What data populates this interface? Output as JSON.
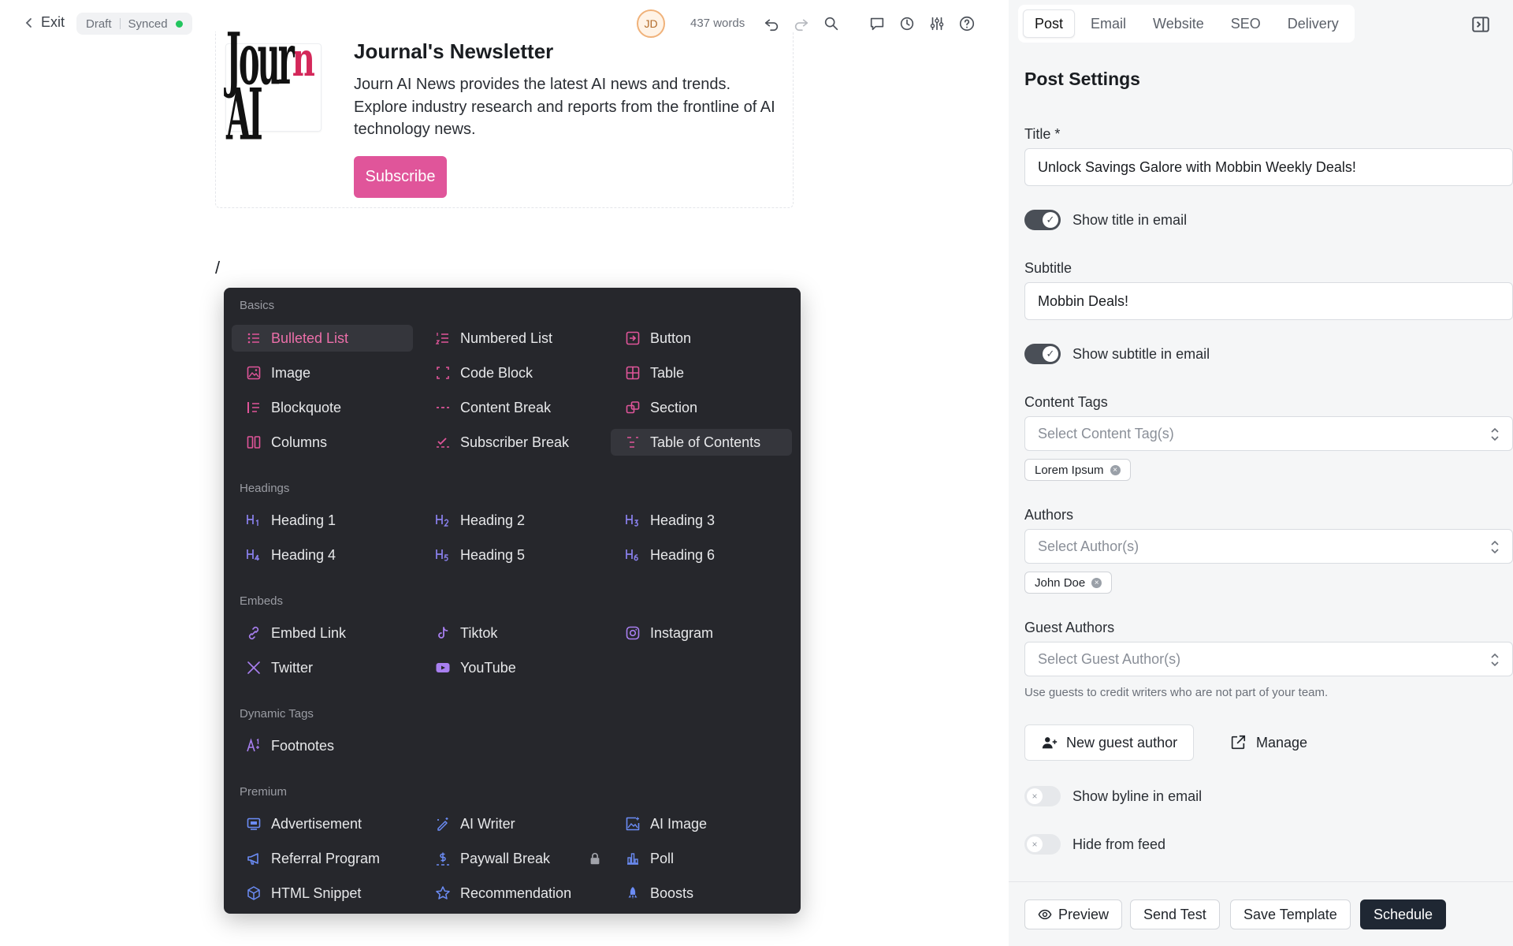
{
  "topbar": {
    "exit_label": "Exit",
    "status_draft": "Draft",
    "status_synced": "Synced",
    "avatar_initials": "JD",
    "word_count": "437 words"
  },
  "card": {
    "logo_text_a": "Jour",
    "logo_text_b": "n",
    "logo_text_c": " AI",
    "title": "Journal's Newsletter",
    "description": "Journ AI News provides the latest AI news and trends. Explore industry research and reports from the frontline of AI technology news.",
    "subscribe_label": "Subscribe"
  },
  "editor": {
    "slash": "/"
  },
  "menu": {
    "sections": {
      "basics": "Basics",
      "headings": "Headings",
      "embeds": "Embeds",
      "dynamic": "Dynamic Tags",
      "premium": "Premium"
    },
    "items": {
      "bulleted_list": "Bulleted List",
      "numbered_list": "Numbered List",
      "button": "Button",
      "image": "Image",
      "code_block": "Code Block",
      "table": "Table",
      "blockquote": "Blockquote",
      "content_break": "Content Break",
      "section": "Section",
      "columns": "Columns",
      "subscriber_break": "Subscriber Break",
      "table_of_contents": "Table of Contents",
      "heading1": "Heading 1",
      "heading2": "Heading 2",
      "heading3": "Heading 3",
      "heading4": "Heading 4",
      "heading5": "Heading 5",
      "heading6": "Heading 6",
      "embed_link": "Embed Link",
      "tiktok": "Tiktok",
      "instagram": "Instagram",
      "twitter": "Twitter",
      "youtube": "YouTube",
      "footnotes": "Footnotes",
      "advertisement": "Advertisement",
      "ai_writer": "AI Writer",
      "ai_image": "AI Image",
      "referral_program": "Referral Program",
      "paywall_break": "Paywall Break",
      "poll": "Poll",
      "html_snippet": "HTML Snippet",
      "recommendation": "Recommendation",
      "boosts": "Boosts"
    }
  },
  "sidebar": {
    "tabs": [
      "Post",
      "Email",
      "Website",
      "SEO",
      "Delivery"
    ],
    "heading": "Post Settings",
    "title_label": "Title *",
    "title_value": "Unlock Savings Galore with Mobbin Weekly Deals!",
    "show_title_label": "Show title in email",
    "subtitle_label": "Subtitle",
    "subtitle_value": "Mobbin Deals!",
    "show_subtitle_label": "Show subtitle in email",
    "content_tags_label": "Content Tags",
    "content_tags_placeholder": "Select Content Tag(s)",
    "content_tag_chip": "Lorem Ipsum",
    "authors_label": "Authors",
    "authors_placeholder": "Select Author(s)",
    "author_chip": "John Doe",
    "guest_authors_label": "Guest Authors",
    "guest_authors_placeholder": "Select Guest Author(s)",
    "guest_hint": "Use guests to credit writers who are not part of your team.",
    "new_guest_label": "New guest author",
    "manage_label": "Manage",
    "show_byline_label": "Show byline in email",
    "hide_feed_label": "Hide from feed"
  },
  "footer": {
    "preview": "Preview",
    "send_test": "Send Test",
    "save_template": "Save Template",
    "schedule": "Schedule"
  },
  "colors": {
    "accent_pink": "#e0559a",
    "menu_bg": "#26272c",
    "primary_dark": "#1f2733",
    "synced_green": "#22c55e"
  }
}
